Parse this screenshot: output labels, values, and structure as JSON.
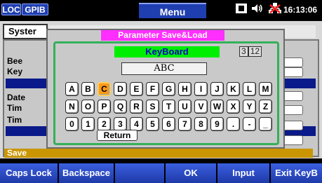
{
  "status": {
    "loc_label": "LOC",
    "gpib_label": "GPIB",
    "menu_title": "Menu",
    "clock": "16:13:06"
  },
  "background": {
    "tab_label": "Syster",
    "rows": [
      "Bee",
      "Key",
      "Date",
      "Tim",
      "Tim"
    ],
    "gold_label": "Save"
  },
  "dialog": {
    "title": "Parameter Save&Load",
    "keyboard_title": "KeyBoard",
    "counter": [
      "3",
      "12"
    ],
    "input_value": "ABC",
    "key_rows": [
      [
        "A",
        "B",
        "C",
        "D",
        "E",
        "F",
        "G",
        "H",
        "I",
        "J",
        "K",
        "L",
        "M"
      ],
      [
        "N",
        "O",
        "P",
        "Q",
        "R",
        "S",
        "T",
        "U",
        "V",
        "W",
        "X",
        "Y",
        "Z"
      ],
      [
        "0",
        "1",
        "2",
        "3",
        "4",
        "5",
        "6",
        "7",
        "8",
        "9",
        ".",
        "-",
        "_"
      ]
    ],
    "selected_key": "C",
    "return_label": "Return"
  },
  "softkeys": [
    "Caps Lock",
    "Backspace",
    "",
    "OK",
    "Input",
    "Exit KeyB"
  ],
  "colors": {
    "accent_blue": "#1f3fb0",
    "title_magenta": "#ff2fff",
    "keyboard_green": "#00ee00",
    "selected_orange": "#ff9a1a"
  }
}
